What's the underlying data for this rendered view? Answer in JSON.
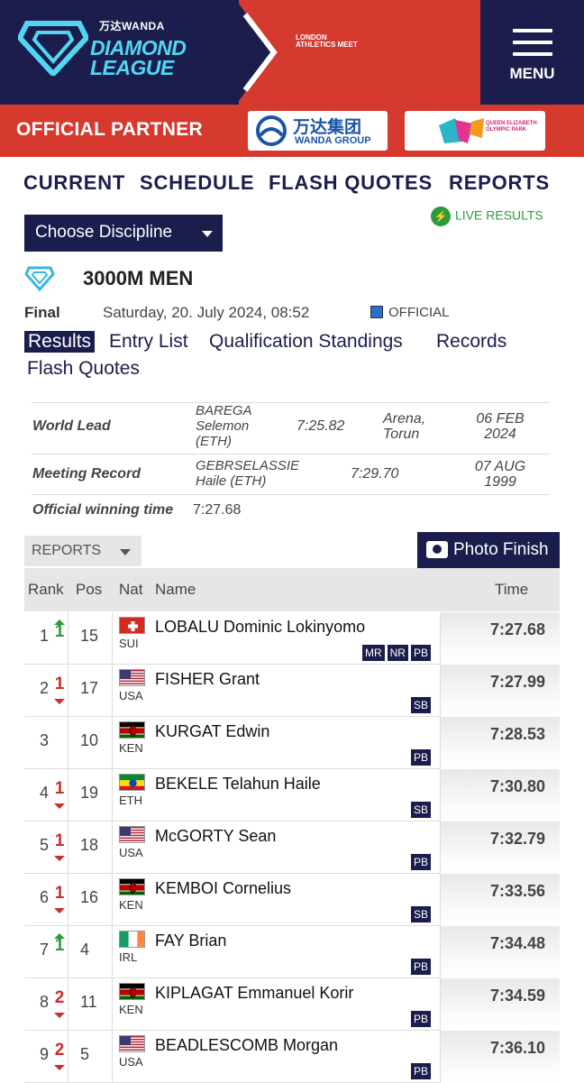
{
  "header": {
    "brand_sub": "万达WANDA",
    "brand_line1": "DIAMOND",
    "brand_line2": "LEAGUE",
    "meet": "LONDON ATHLETICS MEET",
    "menu_label": "MENU"
  },
  "partner": {
    "label": "OFFICIAL PARTNER",
    "wanda_cn": "万达集团",
    "wanda_en": "WANDA GROUP",
    "qe_text": "QUEEN ELIZABETH OLYMPIC PARK"
  },
  "nav": [
    "CURRENT",
    "SCHEDULE",
    "FLASH QUOTES",
    "REPORTS"
  ],
  "live_results": "LIVE RESULTS",
  "choose_discipline": "Choose Discipline",
  "event": {
    "title": "3000M MEN",
    "round": "Final",
    "date": "Saturday, 20. July 2024, 08:52",
    "status": "OFFICIAL"
  },
  "tabs": [
    "Results",
    "Entry List",
    "Qualification Standings",
    "Records",
    "Flash Quotes"
  ],
  "records": {
    "world_lead": {
      "label": "World Lead",
      "athlete_l1": "BAREGA",
      "athlete_l2": "Selemon",
      "athlete_l3": "(ETH)",
      "mark": "7:25.82",
      "venue_l1": "Arena,",
      "venue_l2": "Torun",
      "date_l1": "06 FEB",
      "date_l2": "2024"
    },
    "meeting_record": {
      "label": "Meeting Record",
      "athlete_l1": "GEBRSELASSIE",
      "athlete_l2": "Haile (ETH)",
      "mark": "7:29.70",
      "date_l1": "07 AUG",
      "date_l2": "1999"
    },
    "winning": {
      "label": "Official winning time",
      "mark": "7:27.68"
    }
  },
  "reports_dropdown": "REPORTS",
  "photo_finish": "Photo Finish",
  "table": {
    "headers": {
      "rank": "Rank",
      "pos": "Pos",
      "nat": "Nat",
      "name": "Name",
      "time": "Time"
    },
    "rows": [
      {
        "rank": "1",
        "move": "up",
        "move_n": "1",
        "pos": "15",
        "nat": "SUI",
        "name": "LOBALU Dominic Lokinyomo",
        "badges": [
          "MR",
          "NR",
          "PB"
        ],
        "time": "7:27.68"
      },
      {
        "rank": "2",
        "move": "down",
        "move_n": "1",
        "pos": "17",
        "nat": "USA",
        "name": "FISHER Grant",
        "badges": [
          "SB"
        ],
        "time": "7:27.99"
      },
      {
        "rank": "3",
        "move": "none",
        "move_n": "",
        "pos": "10",
        "nat": "KEN",
        "name": "KURGAT Edwin",
        "badges": [
          "PB"
        ],
        "time": "7:28.53"
      },
      {
        "rank": "4",
        "move": "down",
        "move_n": "1",
        "pos": "19",
        "nat": "ETH",
        "name": "BEKELE Telahun Haile",
        "badges": [
          "SB"
        ],
        "time": "7:30.80"
      },
      {
        "rank": "5",
        "move": "down",
        "move_n": "1",
        "pos": "18",
        "nat": "USA",
        "name": "McGORTY Sean",
        "badges": [
          "PB"
        ],
        "time": "7:32.79"
      },
      {
        "rank": "6",
        "move": "down",
        "move_n": "1",
        "pos": "16",
        "nat": "KEN",
        "name": "KEMBOI Cornelius",
        "badges": [
          "SB"
        ],
        "time": "7:33.56"
      },
      {
        "rank": "7",
        "move": "up",
        "move_n": "1",
        "pos": "4",
        "nat": "IRL",
        "name": "FAY Brian",
        "badges": [
          "PB"
        ],
        "time": "7:34.48"
      },
      {
        "rank": "8",
        "move": "down",
        "move_n": "2",
        "pos": "11",
        "nat": "KEN",
        "name": "KIPLAGAT Emmanuel Korir",
        "badges": [
          "PB"
        ],
        "time": "7:34.59"
      },
      {
        "rank": "9",
        "move": "down",
        "move_n": "2",
        "pos": "5",
        "nat": "USA",
        "name": "BEADLESCOMB Morgan",
        "badges": [
          "PB"
        ],
        "time": "7:36.10"
      }
    ]
  }
}
